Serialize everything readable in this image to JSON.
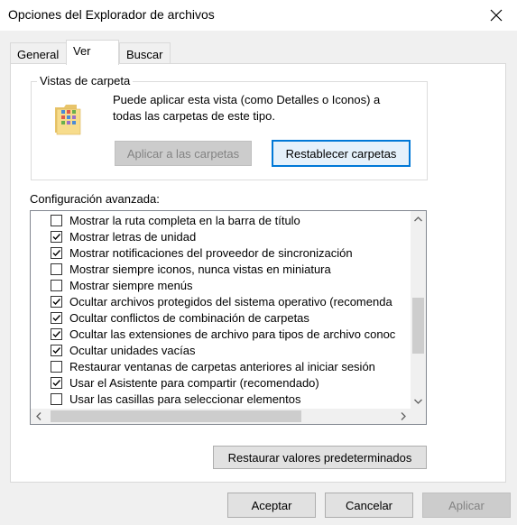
{
  "window": {
    "title": "Opciones del Explorador de archivos"
  },
  "tabs": [
    {
      "label": "General",
      "active": false
    },
    {
      "label": "Ver",
      "active": true
    },
    {
      "label": "Buscar",
      "active": false
    }
  ],
  "folder_views": {
    "group_title": "Vistas de carpeta",
    "description": "Puede aplicar esta vista (como Detalles o Iconos) a todas las carpetas de este tipo.",
    "apply_button": "Aplicar a las carpetas",
    "reset_button": "Restablecer carpetas",
    "icon": "folder-icon"
  },
  "advanced": {
    "label": "Configuración avanzada:",
    "items": [
      {
        "label": "Mostrar la ruta completa en la barra de título",
        "checked": false
      },
      {
        "label": "Mostrar letras de unidad",
        "checked": true
      },
      {
        "label": "Mostrar notificaciones del proveedor de sincronización",
        "checked": true
      },
      {
        "label": "Mostrar siempre iconos, nunca vistas en miniatura",
        "checked": false
      },
      {
        "label": "Mostrar siempre menús",
        "checked": false
      },
      {
        "label": "Ocultar archivos protegidos del sistema operativo (recomenda",
        "checked": true
      },
      {
        "label": "Ocultar conflictos de combinación de carpetas",
        "checked": true
      },
      {
        "label": "Ocultar las extensiones de archivo para tipos de archivo conoc",
        "checked": true
      },
      {
        "label": "Ocultar unidades vacías",
        "checked": true
      },
      {
        "label": "Restaurar ventanas de carpetas anteriores al iniciar sesión",
        "checked": false
      },
      {
        "label": "Usar el Asistente para compartir (recomendado)",
        "checked": true
      },
      {
        "label": "Usar las casillas para seleccionar elementos",
        "checked": false
      }
    ]
  },
  "restore_defaults_button": "Restaurar valores predeterminados",
  "footer": {
    "ok": "Aceptar",
    "cancel": "Cancelar",
    "apply": "Aplicar"
  },
  "colors": {
    "focus_border": "#0078d7",
    "disabled_text": "#838383"
  }
}
